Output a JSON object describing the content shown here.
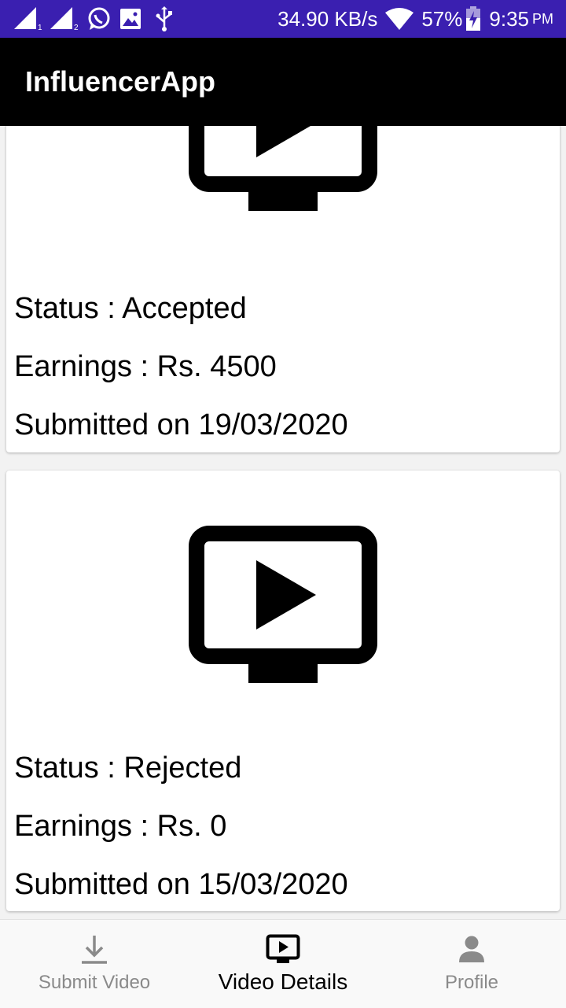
{
  "status_bar": {
    "network_speed": "34.90 KB/s",
    "battery": "57%",
    "time": "9:35",
    "ampm": "PM",
    "icons": [
      "signal-1-icon",
      "signal-2-icon",
      "whatsapp-icon",
      "image-icon",
      "usb-icon",
      "wifi-icon",
      "battery-icon"
    ]
  },
  "app_bar": {
    "title": "InfluencerApp"
  },
  "videos": [
    {
      "icon": "video-tv-icon",
      "status": "Status : Accepted",
      "earnings": "Earnings : Rs. 4500",
      "submitted": "Submitted on 19/03/2020"
    },
    {
      "icon": "video-tv-icon",
      "status": "Status : Rejected",
      "earnings": "Earnings : Rs. 0",
      "submitted": "Submitted on 15/03/2020"
    }
  ],
  "bottom_nav": {
    "items": [
      {
        "label": "Submit Video",
        "icon": "download-icon",
        "active": false
      },
      {
        "label": "Video Details",
        "icon": "video-tv-icon",
        "active": true
      },
      {
        "label": "Profile",
        "icon": "person-icon",
        "active": false
      }
    ],
    "active_color": "#000000",
    "inactive_color": "#8a8a8a"
  },
  "colors": {
    "status_bar": "#3a1fb0",
    "app_bar": "#000000",
    "background": "#f2f2f2",
    "card": "#ffffff"
  }
}
